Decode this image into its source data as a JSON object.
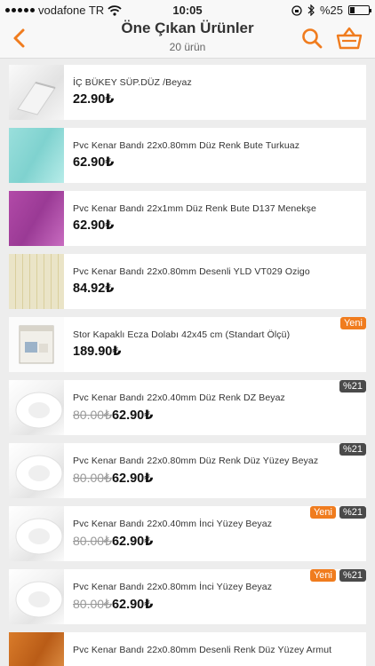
{
  "status": {
    "carrier": "vodafone TR",
    "time": "10:05",
    "battery": "%25",
    "battery_level": 0.25
  },
  "header": {
    "title": "Öne Çıkan Ürünler",
    "subtitle": "20 ürün"
  },
  "colors": {
    "accent": "#f07c1e",
    "badge_discount": "#4a4a4a"
  },
  "products": [
    {
      "name": "İÇ BÜKEY SÜP.DÜZ /Beyaz",
      "price": "22.90₺",
      "old_price": "",
      "badge_new": "",
      "badge_discount": ""
    },
    {
      "name": "Pvc Kenar Bandı 22x0.80mm Düz Renk Bute Turkuaz",
      "price": "62.90₺",
      "old_price": "",
      "badge_new": "",
      "badge_discount": ""
    },
    {
      "name": "Pvc Kenar Bandı 22x1mm Düz Renk Bute D137 Menekşe",
      "price": "62.90₺",
      "old_price": "",
      "badge_new": "",
      "badge_discount": ""
    },
    {
      "name": "Pvc Kenar Bandı 22x0.80mm Desenli YLD VT029 Ozigo",
      "price": "84.92₺",
      "old_price": "",
      "badge_new": "",
      "badge_discount": ""
    },
    {
      "name": "Stor Kapaklı Ecza Dolabı  42x45 cm (Standart Ölçü)",
      "price": "189.90₺",
      "old_price": "",
      "badge_new": "Yeni",
      "badge_discount": ""
    },
    {
      "name": "Pvc Kenar Bandı 22x0.40mm Düz Renk DZ Beyaz",
      "price": "62.90₺",
      "old_price": "80.00₺",
      "badge_new": "",
      "badge_discount": "%21"
    },
    {
      "name": "Pvc Kenar Bandı 22x0.80mm Düz Renk Düz Yüzey Beyaz",
      "price": "62.90₺",
      "old_price": "80.00₺",
      "badge_new": "",
      "badge_discount": "%21"
    },
    {
      "name": "Pvc Kenar Bandı 22x0.40mm İnci Yüzey Beyaz",
      "price": "62.90₺",
      "old_price": "80.00₺",
      "badge_new": "Yeni",
      "badge_discount": "%21"
    },
    {
      "name": "Pvc Kenar Bandı 22x0.80mm İnci Yüzey Beyaz",
      "price": "62.90₺",
      "old_price": "80.00₺",
      "badge_new": "Yeni",
      "badge_discount": "%21"
    },
    {
      "name": "Pvc Kenar Bandı 22x0.80mm Desenli Renk Düz Yüzey Armut",
      "price": "",
      "old_price": "",
      "badge_new": "",
      "badge_discount": ""
    }
  ]
}
